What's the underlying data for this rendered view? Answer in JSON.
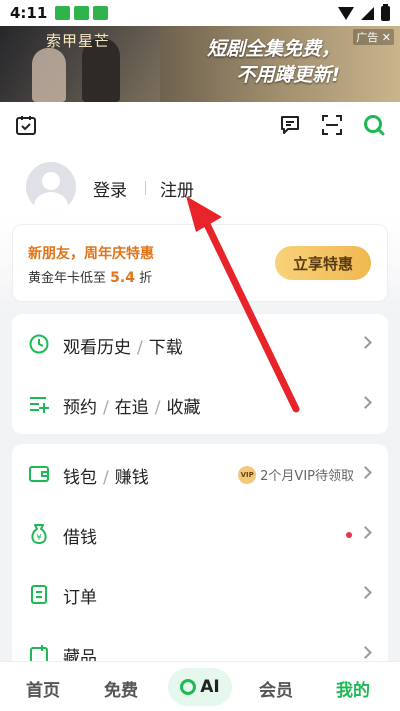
{
  "status_bar": {
    "time": "4:11",
    "notif_icon_text": "iqiyi"
  },
  "ad": {
    "show_title": "索甲星芒",
    "line1": "短剧全集免费，",
    "line2": "不用蹲更新!",
    "label": "广告 ✕"
  },
  "profile": {
    "login": "登录",
    "register": "注册"
  },
  "promo": {
    "title": "新朋友，周年庆特惠",
    "sub_prefix": "黄金年卡低至",
    "sub_highlight": "5.4",
    "sub_suffix": "折",
    "button": "立享特惠"
  },
  "group1": [
    {
      "icon": "history-icon",
      "label_a": "观看历史",
      "label_b": "下载"
    },
    {
      "icon": "subscribe-icon",
      "label_a": "预约",
      "label_b": "在追",
      "label_c": "收藏"
    }
  ],
  "group2": [
    {
      "icon": "wallet-icon",
      "label_a": "钱包",
      "label_b": "赚钱",
      "extra": "2个月VIP待领取",
      "vip_badge": "VIP"
    },
    {
      "icon": "loan-icon",
      "label_a": "借钱"
    },
    {
      "icon": "order-icon",
      "label_a": "订单"
    },
    {
      "icon": "collection-icon",
      "label_a": "藏品"
    }
  ],
  "nav": {
    "home": "首页",
    "free": "免费",
    "ai": "AI",
    "vip": "会员",
    "mine": "我的"
  },
  "colors": {
    "accent_green": "#1db954",
    "promo_orange": "#e0741a",
    "arrow_red": "#e8242a"
  }
}
